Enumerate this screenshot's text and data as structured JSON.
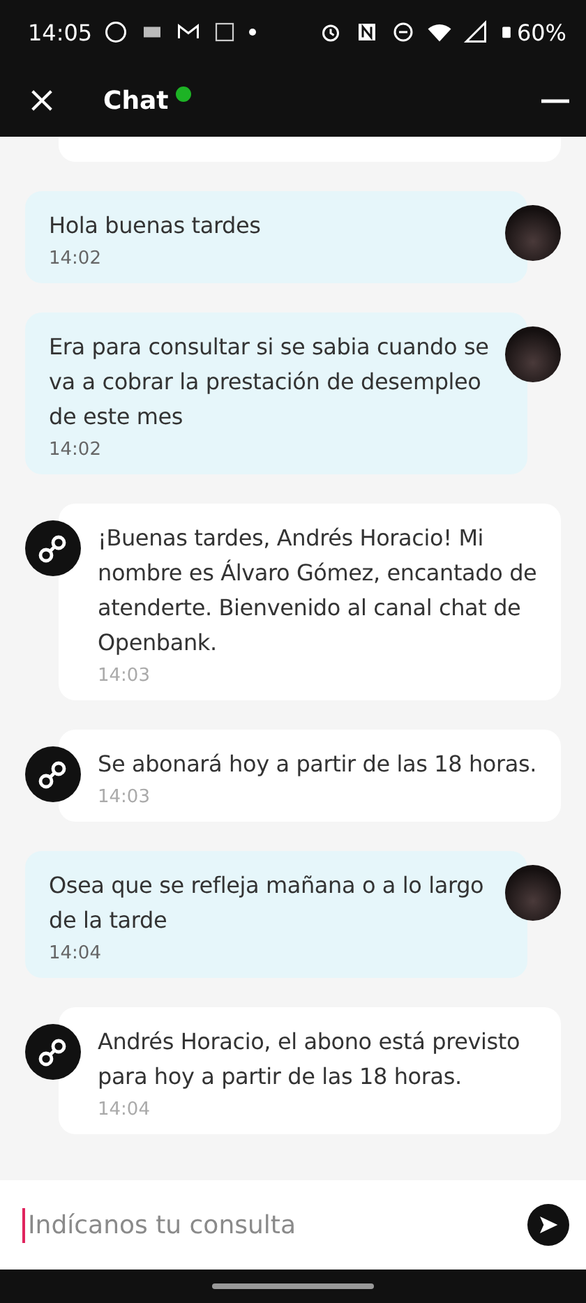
{
  "status_bar": {
    "time": "14:05",
    "battery": "60%"
  },
  "header": {
    "title": "Chat",
    "online": true
  },
  "messages": [
    {
      "kind": "user",
      "text": "Hola buenas tardes",
      "time": "14:02"
    },
    {
      "kind": "user",
      "text": "Era para consultar si se sabia cuando se va a cobrar la prestación de desempleo de este mes",
      "time": "14:02"
    },
    {
      "kind": "agent",
      "text": "¡Buenas tardes, Andrés Horacio! Mi nombre es Álvaro Gómez, encantado de atenderte. Bienvenido al canal chat de Openbank.",
      "time": "14:03"
    },
    {
      "kind": "agent",
      "text": "Se abonará hoy a partir de las 18 horas.",
      "time": "14:03"
    },
    {
      "kind": "user",
      "text": "Osea que se refleja mañana o a lo largo de la tarde",
      "time": "14:04"
    },
    {
      "kind": "agent",
      "text": "Andrés Horacio, el abono está previsto para hoy a partir de las 18 horas.",
      "time": "14:04"
    }
  ],
  "composer": {
    "placeholder": "Indícanos tu consulta"
  }
}
